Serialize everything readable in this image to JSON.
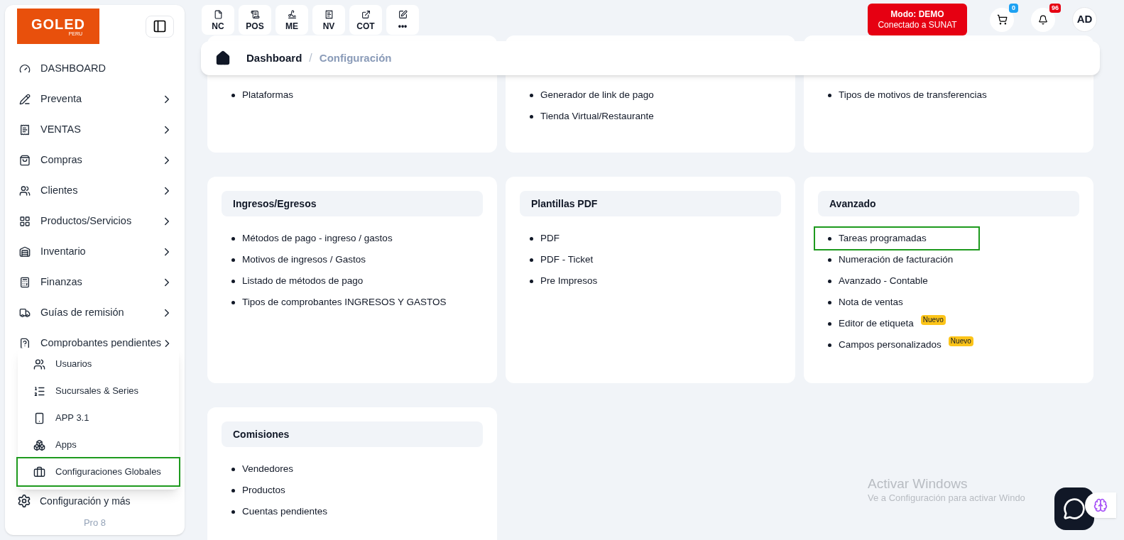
{
  "sidebar": {
    "logo": {
      "text": "GOLED",
      "subtext": "PERU"
    },
    "items": [
      {
        "label": "DASHBOARD",
        "expandable": false
      },
      {
        "label": "Preventa",
        "expandable": true
      },
      {
        "label": "VENTAS",
        "expandable": true
      },
      {
        "label": "Compras",
        "expandable": true
      },
      {
        "label": "Clientes",
        "expandable": true
      },
      {
        "label": "Productos/Servicios",
        "expandable": true
      },
      {
        "label": "Inventario",
        "expandable": true
      },
      {
        "label": "Finanzas",
        "expandable": true
      },
      {
        "label": "Guías de remisión",
        "expandable": true
      },
      {
        "label": "Comprobantes pendientes",
        "expandable": true
      }
    ],
    "submenu": [
      {
        "label": "Usuarios",
        "selected": false
      },
      {
        "label": "Sucursales & Series",
        "selected": false
      },
      {
        "label": "APP 3.1",
        "selected": false
      },
      {
        "label": "Apps",
        "selected": false
      },
      {
        "label": "Configuraciones Globales",
        "selected": true
      }
    ],
    "settings": "Configuración y más",
    "version": "Pro 8"
  },
  "quick_actions": [
    "NC",
    "POS",
    "ME",
    "NV",
    "COT",
    "•••"
  ],
  "mode": {
    "title": "Modo: DEMO",
    "subtitle": "Conectado a SUNAT"
  },
  "cart_count": "0",
  "notification_count": "96",
  "avatar": "AD",
  "breadcrumb": {
    "items": [
      "Dashboard",
      "Configuración"
    ],
    "separator": "/"
  },
  "cards": [
    {
      "items": [
        {
          "label": "Plataformas",
          "selected": false
        }
      ]
    },
    {
      "items": [
        {
          "label": "Generador de link de pago",
          "selected": false
        },
        {
          "label": "Tienda Virtual/Restaurante",
          "selected": false
        }
      ]
    },
    {
      "items": [
        {
          "label": "Tipos de motivos de transferencias",
          "selected": false
        }
      ]
    },
    {
      "title": "Ingresos/Egresos",
      "items": [
        {
          "label": "Métodos de pago - ingreso / gastos",
          "selected": false
        },
        {
          "label": "Motivos de ingresos / Gastos",
          "selected": false
        },
        {
          "label": "Listado de métodos de pago",
          "selected": false
        },
        {
          "label": "Tipos de comprobantes INGRESOS Y GASTOS",
          "selected": false
        }
      ]
    },
    {
      "title": "Plantillas PDF",
      "items": [
        {
          "label": "PDF",
          "selected": false
        },
        {
          "label": "PDF - Ticket",
          "selected": false
        },
        {
          "label": "Pre Impresos",
          "selected": false
        }
      ]
    },
    {
      "title": "Avanzado",
      "items": [
        {
          "label": "Tareas programadas",
          "selected": true
        },
        {
          "label": "Numeración de facturación",
          "selected": false
        },
        {
          "label": "Avanzado - Contable",
          "selected": false
        },
        {
          "label": "Nota de ventas",
          "selected": false
        },
        {
          "label": "Editor de etiqueta",
          "selected": false,
          "badge": "Nuevo"
        },
        {
          "label": "Campos personalizados",
          "selected": false,
          "badge": "Nuevo"
        }
      ]
    },
    {
      "title": "Comisiones",
      "items": [
        {
          "label": "Vendedores",
          "selected": false
        },
        {
          "label": "Productos",
          "selected": false
        },
        {
          "label": "Cuentas pendientes",
          "selected": false
        }
      ]
    }
  ],
  "os_notice": {
    "title": "Activar Windows",
    "text": "Ve a Configuración para activar Windo"
  }
}
